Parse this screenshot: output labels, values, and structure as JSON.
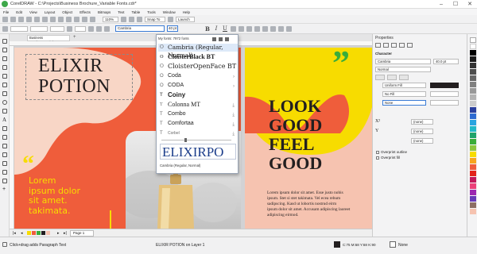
{
  "window": {
    "title": "CorelDRAW - C:\\Projects\\Business Brochure_Variable Fonts.cdr*"
  },
  "menu": [
    "File",
    "Edit",
    "View",
    "Layout",
    "Object",
    "Effects",
    "Bitmaps",
    "Text",
    "Table",
    "Tools",
    "Window",
    "Help"
  ],
  "toolbar": {
    "zoom": "110%",
    "snap": "Snap To",
    "launch": "Launch"
  },
  "propbar": {
    "font": "Cambria",
    "size": "40 pt"
  },
  "doc_tab": "Business Brochure_Variab...",
  "font_list": {
    "header": "My fonts: 7972 fonts",
    "items": [
      "Cambria (Regular, Normal)",
      "CloisterBlack BT",
      "CloisterOpenFace BT",
      "Coda",
      "CODA",
      "Coiny",
      "Colonna MT",
      "Combo",
      "Comfortaa",
      "Corbel"
    ],
    "preview_text": "ELIXIRPO",
    "preview_caption": "Cambria (Regular, Normal)"
  },
  "page1": {
    "heading_line1": "ELIXIR",
    "heading_line2": "POTION",
    "quote_mark": "“",
    "body": [
      "Lorem",
      "ipsum dolor",
      "sit amet.",
      "takimata."
    ]
  },
  "page2": {
    "quote_mark": "”",
    "heading": [
      "LOOK",
      "GOOD",
      "FEEL",
      "GOOD"
    ],
    "body": [
      "Lorem ipsum dolor sit amet. Esse justo nobis",
      "ipsum. Stet si stet takimata. Vel ecea rebum",
      "sadipscing. Kasd ut lobortis nostrud eirm",
      "ipsum dolor sit amet. Accusam adipiscing laoreet",
      "adipiscing eirmod."
    ]
  },
  "properties": {
    "title": "Properties",
    "section": "Character",
    "font": "Cambria",
    "size": "40.0 pt",
    "style": "Normal",
    "fill1": "Uniform Fill",
    "fill2": "No Fill",
    "fill3": "None",
    "opt1": "(none)",
    "opt2": "(none)",
    "opt3": "(none)",
    "check1": "Overprint outline",
    "check2": "Overprint fill"
  },
  "page_tab": "Page 1",
  "status": {
    "hint": "Click+drag adds Paragraph Text",
    "object": "ELIXIR POTION on Layer 1",
    "color": "C:75 M:68 Y:68 K:90",
    "fill": "None"
  },
  "colors": {
    "orange": "#ef5d3b",
    "yellow": "#f7dc00",
    "pink": "#f6c3b0",
    "green": "#3aad3a",
    "dark": "#231f20"
  }
}
